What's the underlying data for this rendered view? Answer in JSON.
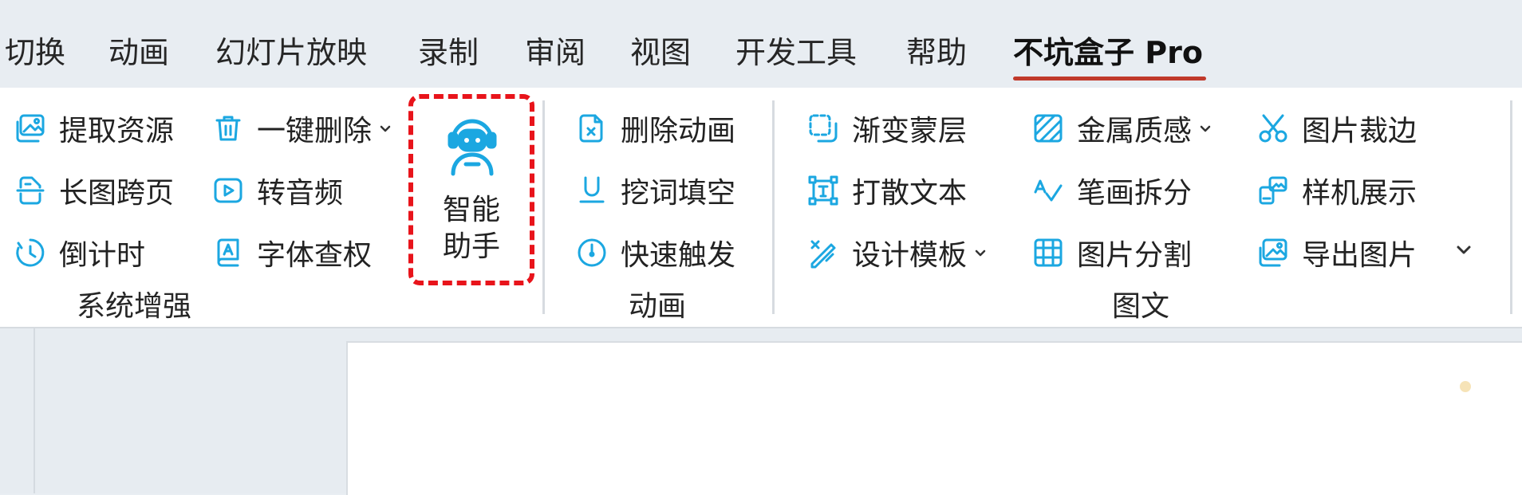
{
  "tabs": [
    "切换",
    "动画",
    "幻灯片放映",
    "录制",
    "审阅",
    "视图",
    "开发工具",
    "帮助",
    "不坑盒子 Pro"
  ],
  "active_tab": "不坑盒子 Pro",
  "accent_color": "#1ba7e1",
  "highlight_color": "#e8141b",
  "underline_color": "#c0392b",
  "groups": {
    "system": {
      "label": "系统增强",
      "items": [
        {
          "label": "提取资源",
          "icon": "image-extract-icon"
        },
        {
          "label": "长图跨页",
          "icon": "long-image-icon"
        },
        {
          "label": "倒计时",
          "icon": "timer-icon"
        },
        {
          "label": "一键删除",
          "icon": "trash-icon"
        },
        {
          "label": "转音频",
          "icon": "play-icon"
        },
        {
          "label": "字体查权",
          "icon": "font-book-icon"
        }
      ]
    },
    "assistant": {
      "label_line1": "智能",
      "label_line2": "助手",
      "icon": "robot-icon"
    },
    "animation": {
      "label": "动画",
      "items": [
        {
          "label": "删除动画",
          "icon": "delete-doc-icon"
        },
        {
          "label": "挖词填空",
          "icon": "underline-icon"
        },
        {
          "label": "快速触发",
          "icon": "clock-trigger-icon"
        }
      ]
    },
    "graphics": {
      "label": "图文",
      "items": [
        {
          "label": "渐变蒙层",
          "icon": "gradient-mask-icon"
        },
        {
          "label": "打散文本",
          "icon": "split-text-icon"
        },
        {
          "label": "设计模板",
          "icon": "design-template-icon"
        },
        {
          "label": "金属质感",
          "icon": "metal-texture-icon"
        },
        {
          "label": "笔画拆分",
          "icon": "stroke-split-icon"
        },
        {
          "label": "图片分割",
          "icon": "grid-split-icon"
        },
        {
          "label": "图片裁边",
          "icon": "scissors-icon"
        },
        {
          "label": "样机展示",
          "icon": "mockup-icon"
        },
        {
          "label": "导出图片",
          "icon": "export-image-icon"
        }
      ]
    }
  }
}
